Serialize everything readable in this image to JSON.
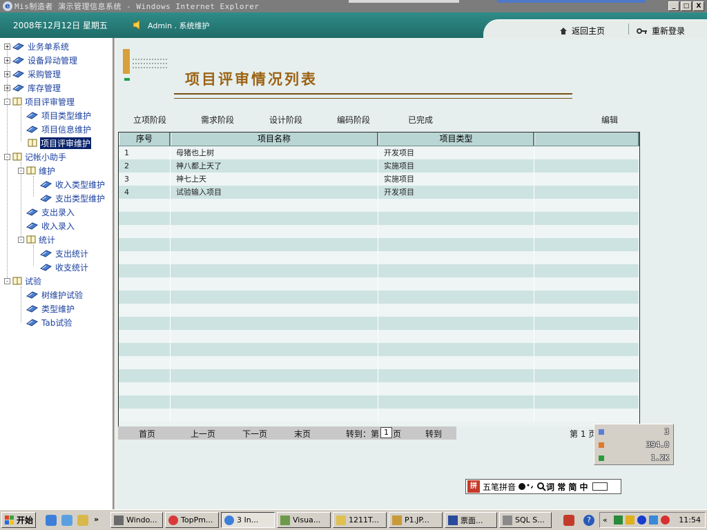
{
  "window": {
    "title": "Mis制造者  演示管理信息系统 - Windows Internet Explorer",
    "controls": [
      "_",
      "□",
      "X"
    ]
  },
  "header": {
    "date": "2008年12月12日 星期五",
    "user": "Admin . 系统维护",
    "home": "返回主页",
    "relogin": "重新登录"
  },
  "tree": {
    "items": [
      {
        "label": "业务单系统"
      },
      {
        "label": "设备异动管理"
      },
      {
        "label": "采购管理"
      },
      {
        "label": "库存管理"
      },
      {
        "label": "项目评审管理"
      },
      {
        "label": "项目类型维护"
      },
      {
        "label": "项目信息维护"
      },
      {
        "label": "项目评审维护"
      },
      {
        "label": "记帐小助手"
      },
      {
        "label": "维护"
      },
      {
        "label": "收入类型维护"
      },
      {
        "label": "支出类型维护"
      },
      {
        "label": "支出录入"
      },
      {
        "label": "收入录入"
      },
      {
        "label": "统计"
      },
      {
        "label": "支出统计"
      },
      {
        "label": "收支统计"
      },
      {
        "label": "试验"
      },
      {
        "label": "树维护试验"
      },
      {
        "label": "类型维护"
      },
      {
        "label": "Tab试验"
      }
    ]
  },
  "main": {
    "title": "项目评审情况列表",
    "stages": [
      "立项阶段",
      "需求阶段",
      "设计阶段",
      "编码阶段",
      "已完成"
    ],
    "edit": "编辑",
    "columns": [
      "序号",
      "项目名称",
      "项目类型",
      ""
    ],
    "rows": [
      [
        "1",
        "母猪也上树",
        "开发项目",
        ""
      ],
      [
        "2",
        "神八都上天了",
        "实施项目",
        ""
      ],
      [
        "3",
        "神七上天",
        "实施项目",
        ""
      ],
      [
        "4",
        "试验输入项目",
        "开发项目",
        ""
      ]
    ],
    "pager": {
      "first": "首页",
      "prev": "上一页",
      "next": "下一页",
      "last": "末页",
      "goto_label": "转到：第",
      "goto_value": "1",
      "goto_suffix": "页",
      "goto_button": "转到",
      "page_info": "第 1 页 / 共 1 页"
    }
  },
  "stats": {
    "values": [
      "3",
      "394.0",
      "1.2K"
    ],
    "colors": [
      "#5b7fd6",
      "#e07a2a",
      "#2a9a3a"
    ]
  },
  "ime": {
    "mode": "五笔拼音",
    "flags": "词 常 简 中"
  },
  "taskbar": {
    "start": "开始",
    "tasks": [
      "Windo...",
      "TopPm...",
      "3 In...",
      "Visua...",
      "1211T...",
      "P1.JP...",
      "票面...",
      "SQL S..."
    ],
    "clock": "11:54"
  }
}
